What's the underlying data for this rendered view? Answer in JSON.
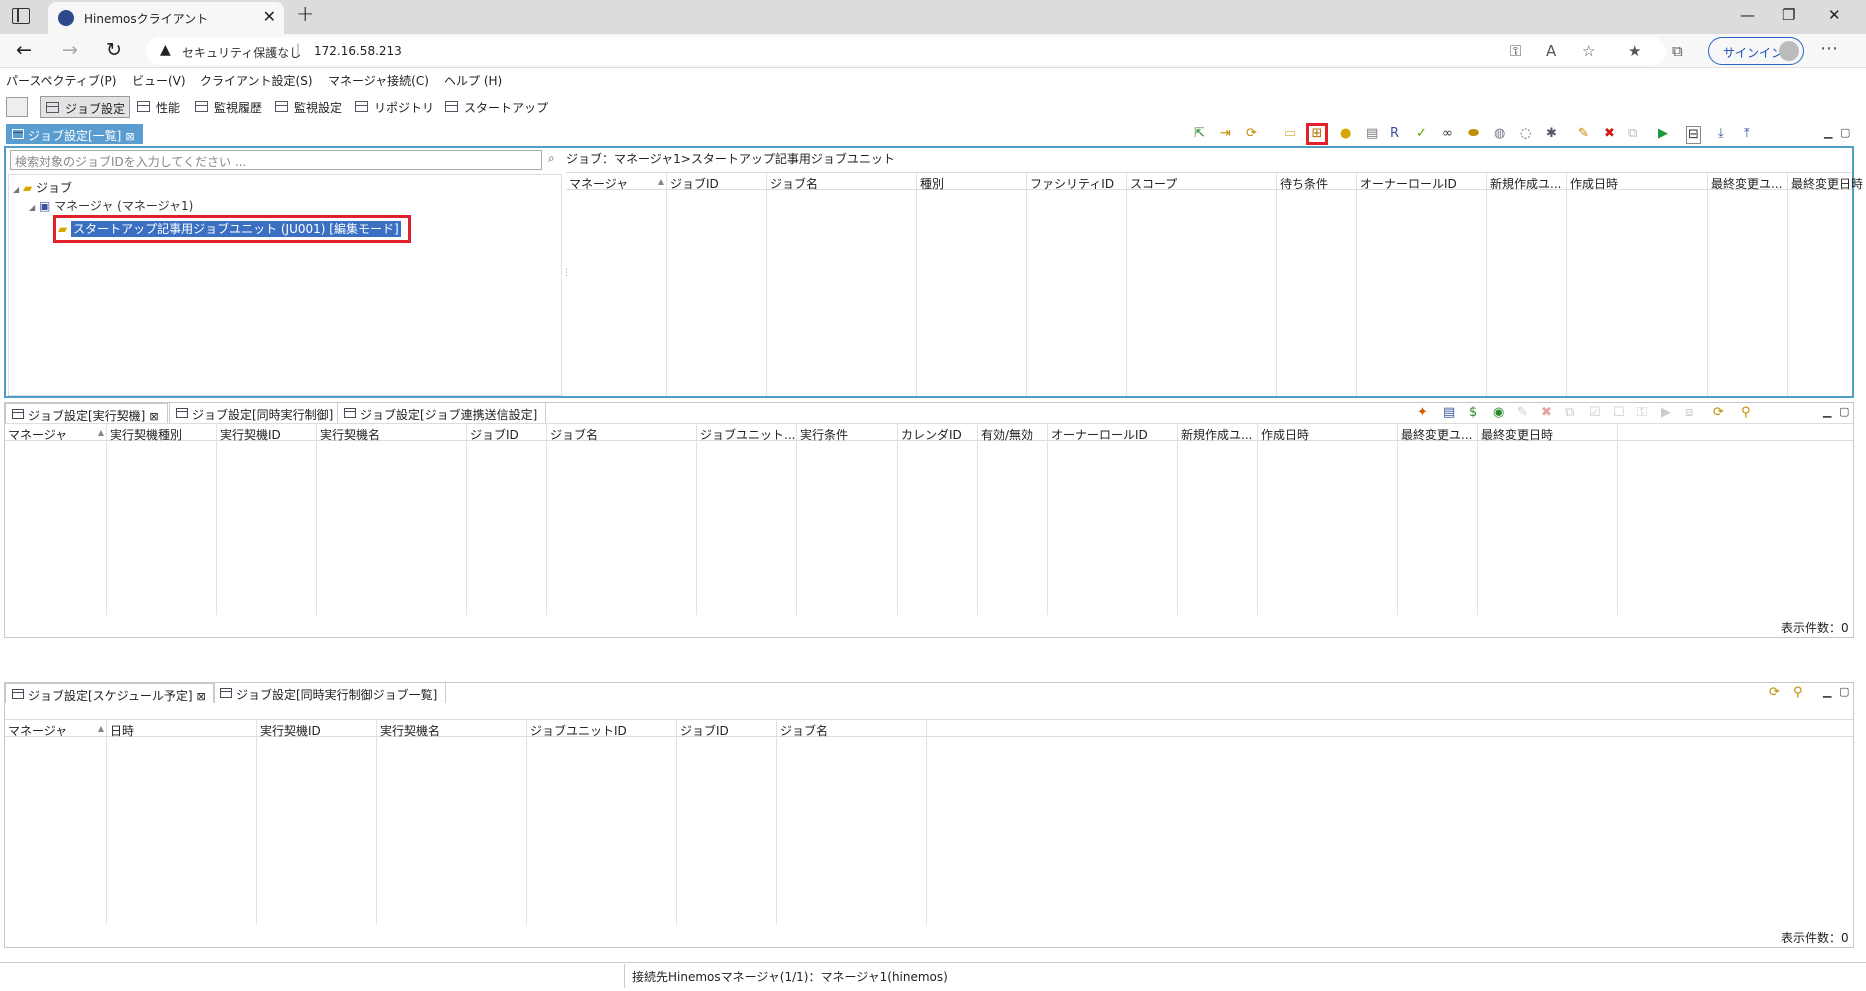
{
  "browser": {
    "tab_title": "Hinemosクライアント",
    "tab_close": "✕",
    "new_tab": "+",
    "security_label": "セキュリティ保護なし",
    "host": "172.16.58.213",
    "signin_label": "サインイン"
  },
  "menubar": [
    "パースペクティブ(P)",
    "ビュー(V)",
    "クライアント設定(S)",
    "マネージャ接続(C)",
    "ヘルプ (H)"
  ],
  "perspectives": [
    "ジョブ設定",
    "性能",
    "監視履歴",
    "監視設定",
    "リポジトリ",
    "スタートアップ"
  ],
  "job_list_view": {
    "tab_label": "ジョブ設定[一覧]",
    "search_placeholder": "検索対象のジョブIDを入力してください ...",
    "breadcrumb": "ジョブ：マネージャ1>スタートアップ記事用ジョブユニット",
    "tree": {
      "root": "ジョブ",
      "manager": "マネージャ (マネージャ1)",
      "jobunit": "スタートアップ記事用ジョブユニット (JU001) [編集モード]"
    },
    "columns": [
      "マネージャ",
      "ジョブID",
      "ジョブ名",
      "種別",
      "ファシリティID",
      "スコープ",
      "待ち条件",
      "オーナーロールID",
      "新規作成ユ...",
      "作成日時",
      "最終変更ユ...",
      "最終変更日時"
    ]
  },
  "trigger_view": {
    "tabs": [
      "ジョブ設定[実行契機]",
      "ジョブ設定[同時実行制御]",
      "ジョブ設定[ジョブ連携送信設定]"
    ],
    "columns": [
      "マネージャ",
      "実行契機種別",
      "実行契機ID",
      "実行契機名",
      "ジョブID",
      "ジョブ名",
      "ジョブユニット...",
      "実行条件",
      "カレンダID",
      "有効/無効",
      "オーナーロールID",
      "新規作成ユ...",
      "作成日時",
      "最終変更ユ...",
      "最終変更日時"
    ],
    "count_label": "表示件数：0"
  },
  "schedule_view": {
    "tabs": [
      "ジョブ設定[スケジュール予定]",
      "ジョブ設定[同時実行制御ジョブ一覧]"
    ],
    "columns": [
      "マネージャ",
      "日時",
      "実行契機ID",
      "実行契機名",
      "ジョブユニットID",
      "ジョブID",
      "ジョブ名"
    ],
    "count_label": "表示件数：0"
  },
  "statusbar": "接続先Hinemosマネージャ(1/1)：マネージャ1(hinemos)",
  "colors": {
    "accent": "#4f9dc8",
    "highlight_red": "#e0202a",
    "selection": "#3a6fc2"
  }
}
